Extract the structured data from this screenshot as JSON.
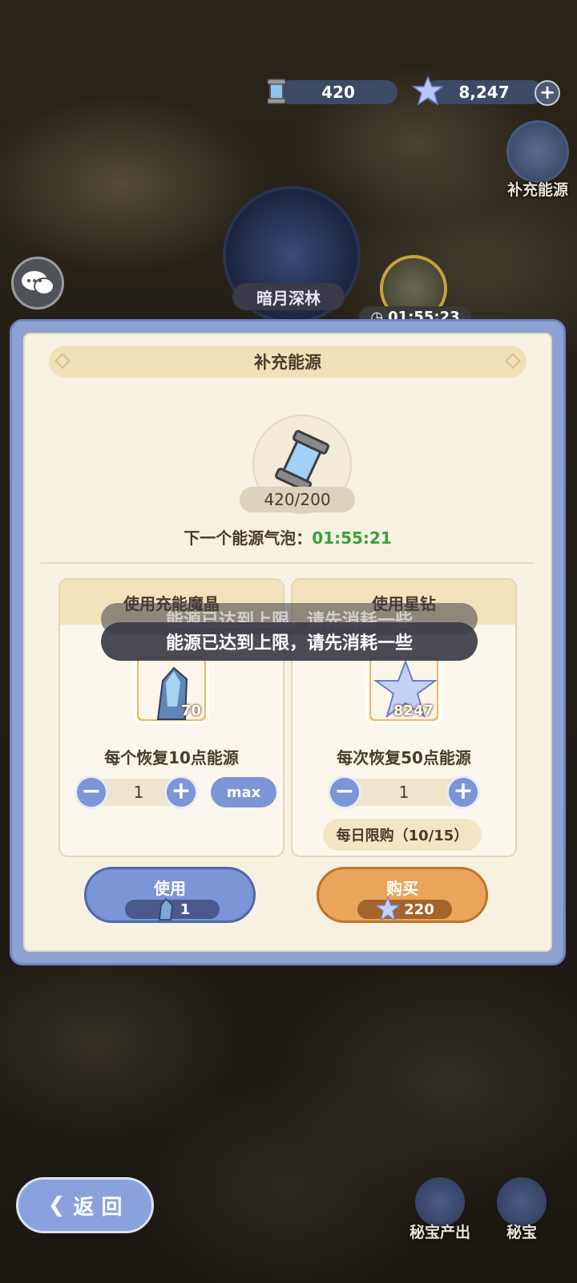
{
  "top_bar": {
    "energy": "420",
    "stars": "8,247",
    "add_label": "+"
  },
  "side": {
    "recharge_label": "补充能源"
  },
  "map": {
    "location_label": "暗月深林",
    "bubble_timer": "01:55:23"
  },
  "dialog": {
    "title": "补充能源",
    "energy_count": "420/200",
    "next_label": "下一个能源气泡：",
    "next_time": "01:55:21",
    "left_card": {
      "title": "使用充能魔晶",
      "item_count": "70",
      "desc": "每个恢复10点能源",
      "quantity": "1",
      "max_label": "max",
      "action_label": "使用",
      "cost": "1"
    },
    "right_card": {
      "title": "使用星钻",
      "item_count": "8247",
      "desc": "每次恢复50点能源",
      "quantity": "1",
      "limit": "每日限购（10/15）",
      "action_label": "购买",
      "cost": "220"
    },
    "minus": "−",
    "plus": "+"
  },
  "toast": {
    "message": "能源已达到上限，请先消耗一些"
  },
  "bottom": {
    "back_label": "返 回",
    "treasure_output": "秘宝产出",
    "treasure": "秘宝"
  },
  "colors": {
    "accent_blue": "#7b95d6",
    "accent_orange": "#eaa55a",
    "timer_green": "#3aa03a"
  }
}
